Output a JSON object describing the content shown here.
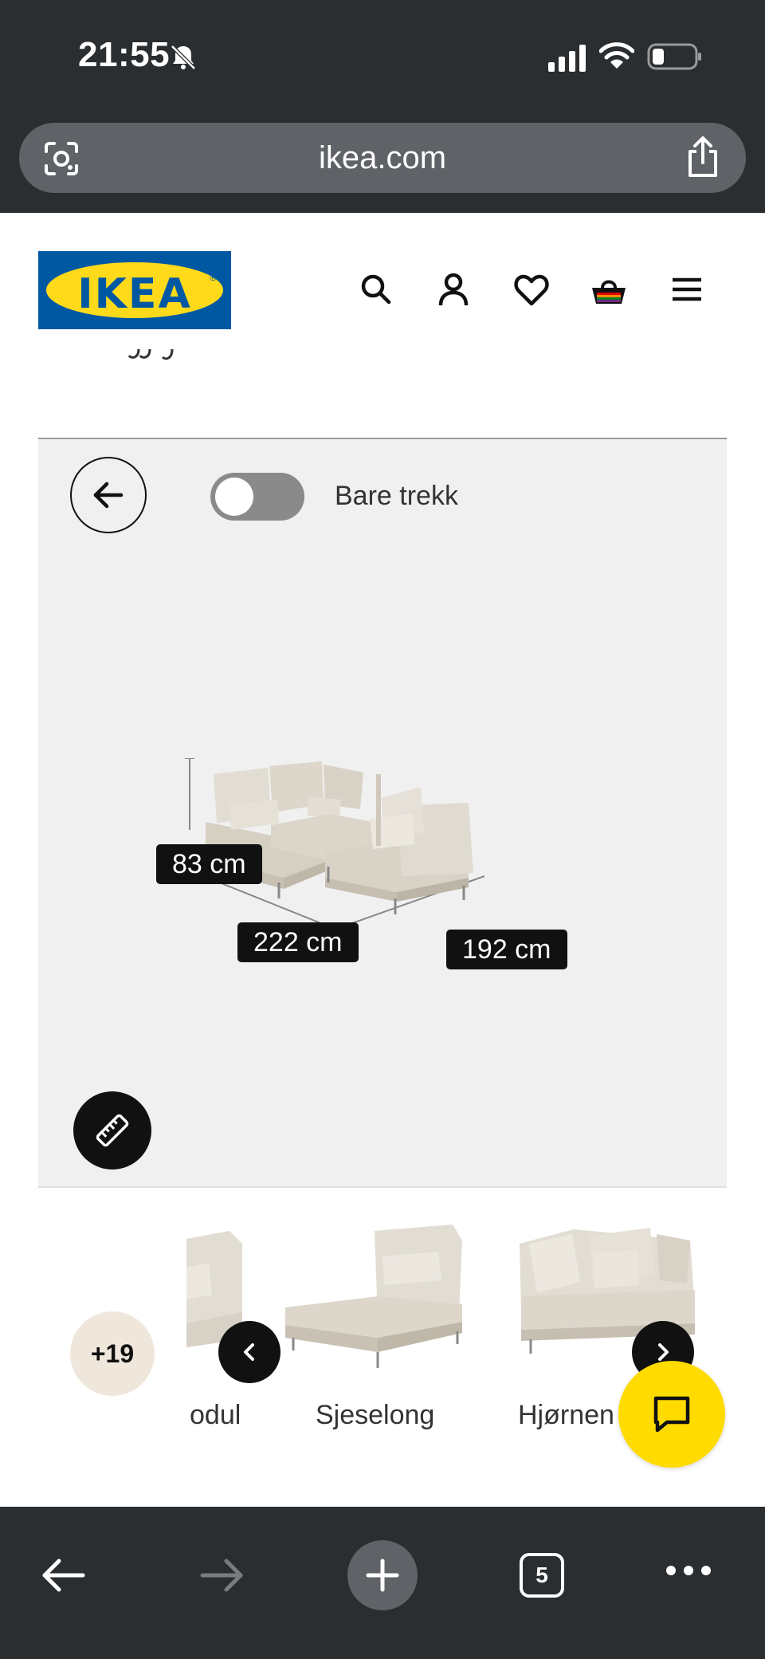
{
  "status_bar": {
    "time": "21:55",
    "icons": [
      "bell-slash-icon",
      "signal-icon",
      "wifi-icon",
      "battery-icon"
    ]
  },
  "browser": {
    "url": "ikea.com",
    "tab_count": "5",
    "icons": [
      "camera-lens-icon",
      "share-icon",
      "back-arrow-icon",
      "forward-arrow-icon",
      "new-tab-icon",
      "tabs-icon",
      "more-icon"
    ]
  },
  "header": {
    "logo_text": "IKEA",
    "icons": [
      "search-icon",
      "account-icon",
      "heart-icon",
      "basket-icon",
      "menu-icon"
    ]
  },
  "viewer": {
    "toggle_label": "Bare trekk",
    "toggle_on": false,
    "dimensions": {
      "height": "83 cm",
      "width": "222 cm",
      "depth": "192 cm"
    }
  },
  "carousel": {
    "more_count": "+19",
    "items": [
      {
        "label": "odul"
      },
      {
        "label": "Sjeselong"
      },
      {
        "label": "Hjørnen"
      }
    ]
  },
  "colors": {
    "ikea_blue": "#0058a3",
    "ikea_yellow": "#ffda1a",
    "chat_yellow": "#ffdb00",
    "chrome_dark": "#2b2e31",
    "viewer_bg": "#f0f0f0",
    "sofa_fabric": "#dcd6ca"
  }
}
